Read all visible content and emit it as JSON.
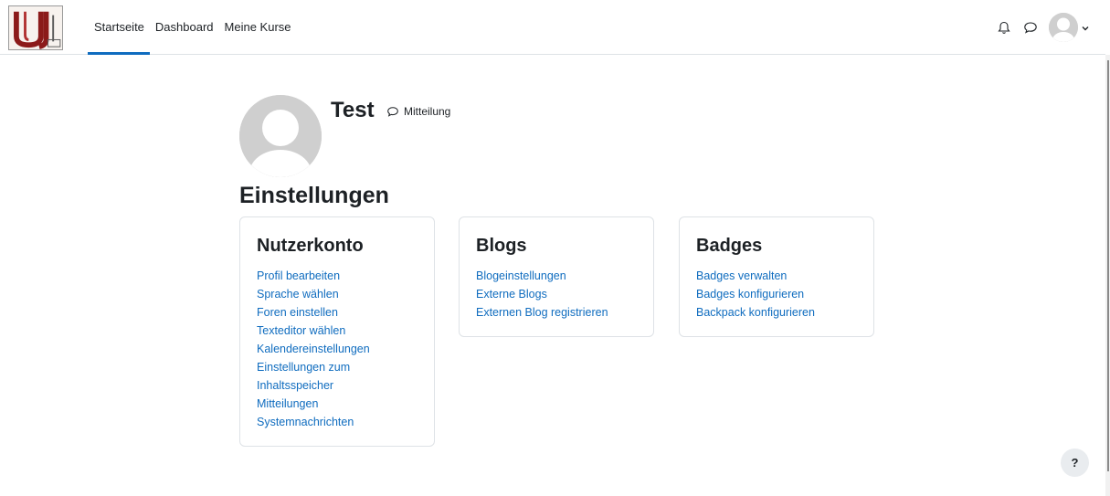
{
  "nav": {
    "logo_icon": "university-crest-logo",
    "links": [
      {
        "label": "Startseite",
        "active": true
      },
      {
        "label": "Dashboard",
        "active": false
      },
      {
        "label": "Meine Kurse",
        "active": false
      }
    ],
    "icons": [
      "bell-icon",
      "message-bubble-icon",
      "user-avatar",
      "chevron-down-icon"
    ]
  },
  "profile": {
    "name": "Test",
    "message_label": "Mitteilung"
  },
  "page": {
    "heading": "Einstellungen"
  },
  "cards": {
    "account": {
      "title": "Nutzerkonto",
      "links": [
        "Profil bearbeiten",
        "Sprache wählen",
        "Foren einstellen",
        "Texteditor wählen",
        "Kalendereinstellungen",
        "Einstellungen zum",
        "Inhaltsspeicher",
        "Mitteilungen",
        "Systemnachrichten"
      ]
    },
    "blogs": {
      "title": "Blogs",
      "links": [
        "Blogeinstellungen",
        "Externe Blogs",
        "Externen Blog registrieren"
      ]
    },
    "badges": {
      "title": "Badges",
      "links": [
        "Badges verwalten",
        "Badges konfigurieren",
        "Backpack konfigurieren"
      ]
    }
  },
  "help": {
    "label": "?"
  },
  "colors": {
    "link": "#0f6cbf",
    "text": "#1d2125",
    "border": "#dee2e6",
    "active_underline": "#0f6cbf"
  }
}
